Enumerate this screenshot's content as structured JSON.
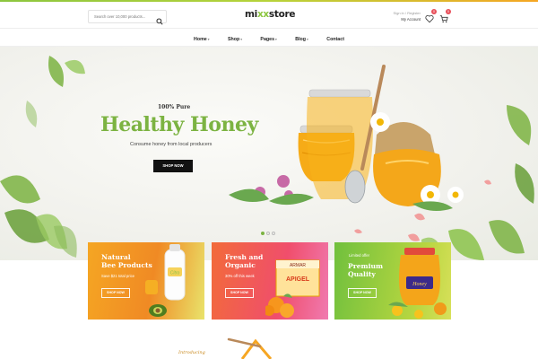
{
  "header": {
    "search_placeholder": "Search over 10,000 products...",
    "logo_prefix": "mi",
    "logo_x": "xx",
    "logo_suffix": "store",
    "signin": "Sign in / Register",
    "account": "My Account",
    "wishlist_count": "0",
    "cart_count": "0"
  },
  "nav": {
    "items": [
      {
        "label": "Home"
      },
      {
        "label": "Shop"
      },
      {
        "label": "Pages"
      },
      {
        "label": "Blog"
      },
      {
        "label": "Contact"
      }
    ]
  },
  "hero": {
    "subtitle": "100% Pure",
    "title": "Healthy Honey",
    "text": "Consume honey from local producers",
    "button": "SHOP NOW",
    "slides": 3,
    "active_slide": 1
  },
  "promos": [
    {
      "eyebrow": "",
      "title_line1": "Natural",
      "title_line2": "Bee Products",
      "text": "Save $21 total price",
      "button": "SHOP NOW",
      "color": "#f5a623"
    },
    {
      "eyebrow": "",
      "title_line1": "Fresh and",
      "title_line2": "Organic",
      "text": "30% off this week",
      "button": "SHOP NOW",
      "color": "#f04e6c"
    },
    {
      "eyebrow": "Limited offer",
      "title_line1": "Premium",
      "title_line2": "Quality",
      "text": "",
      "button": "SHOP NOW",
      "color": "#70c03d"
    }
  ],
  "product_labels": {
    "bottle": "Citro",
    "box_brand": "ARMAR",
    "box_name": "APIGEL",
    "jar": "Honey"
  },
  "bottom": {
    "intro": "Introducing"
  },
  "colors": {
    "accent": "#7cb342",
    "badge": "#e8505b",
    "dark": "#111111"
  }
}
